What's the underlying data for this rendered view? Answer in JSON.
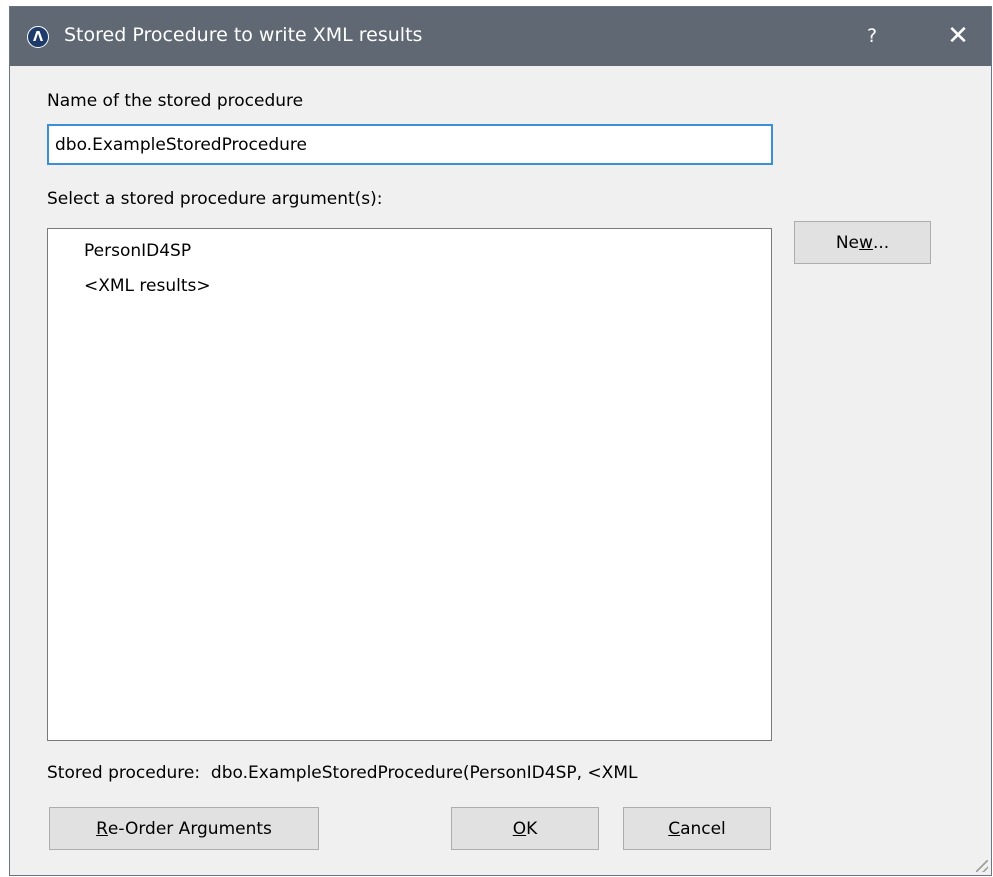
{
  "window": {
    "title": "Stored Procedure to write XML results",
    "icon_glyph": "Λ",
    "help_label": "?",
    "close_label": "✕"
  },
  "name_section": {
    "label": "Name of the stored procedure",
    "value": "dbo.ExampleStoredProcedure"
  },
  "arguments_section": {
    "label": "Select a stored procedure argument(s):",
    "items": [
      {
        "label": "PersonID4SP"
      },
      {
        "label": "<XML results>"
      }
    ],
    "new_button": {
      "pre": "Ne",
      "mnemonic": "w",
      "post": "..."
    }
  },
  "summary": {
    "label": "Stored procedure:",
    "value": "dbo.ExampleStoredProcedure(PersonID4SP, <XML"
  },
  "buttons": {
    "reorder": {
      "mnemonic": "R",
      "rest": "e-Order Arguments"
    },
    "ok": {
      "mnemonic": "O",
      "rest": "K"
    },
    "cancel": {
      "mnemonic": "C",
      "rest": "ancel"
    }
  },
  "colors": {
    "titlebar": "#5f6873",
    "dialog_bg": "#f0f0f0",
    "focus_border": "#3c8fd4",
    "button_bg": "#e1e1e1"
  }
}
